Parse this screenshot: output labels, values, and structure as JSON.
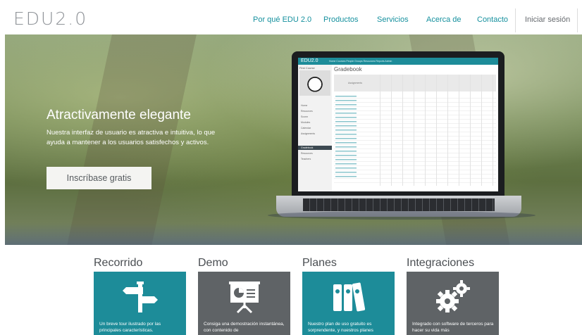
{
  "header": {
    "logo": "EDU2.0",
    "nav": [
      {
        "label": "Por qué EDU 2.0"
      },
      {
        "label": "Productos"
      },
      {
        "label": "Servicios"
      },
      {
        "label": "Acerca de"
      },
      {
        "label": "Contacto"
      }
    ],
    "login": "Iniciar sesión"
  },
  "hero": {
    "title": "Atractivamente elegante",
    "text": "Nuestra interfaz de usuario es atractiva e intuitiva, lo que ayuda a mantener a los usuarios satisfechos y activos.",
    "cta": "Inscríbase gratis"
  },
  "app_preview": {
    "logo": "EDU2.0",
    "menu": "Home  Courses  People  Groups  Resources  Reports  Admin",
    "course": "First Course",
    "heading": "Gradebook",
    "assignments": "Assignments",
    "side_items": [
      "Home",
      "Resources",
      "Scorm",
      "Modules",
      "Calendar",
      "Assignments",
      "Gradebook",
      "Resources",
      "Teachers"
    ]
  },
  "features": [
    {
      "title": "Recorrido",
      "text": "Un breve tour ilustrado por las principales características.",
      "icon": "signpost-icon",
      "color": "#1d8c99"
    },
    {
      "title": "Demo",
      "text": "Consiga una demostración instantánea, con contenido de",
      "icon": "presentation-board-icon",
      "color": "#5f6366"
    },
    {
      "title": "Planes",
      "text": "Nuestro plan de uso gratuito es sorprendente, y nuestros planes",
      "icon": "binders-icon",
      "color": "#1d8c99"
    },
    {
      "title": "Integraciones",
      "text": "Integrado con software de terceros para hacer su vida más",
      "icon": "gears-icon",
      "color": "#5f6366"
    }
  ]
}
